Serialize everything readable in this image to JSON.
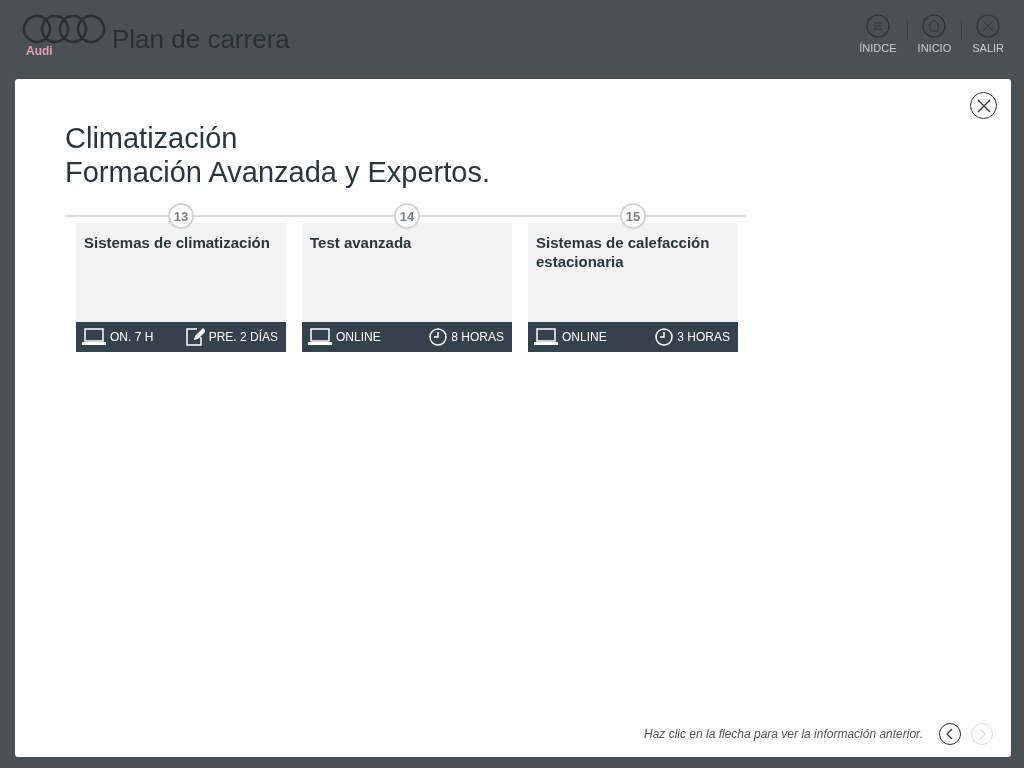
{
  "header": {
    "logo_text": "Audi",
    "title": "Plan de carrera",
    "nav": [
      {
        "label": "ÍNIDCE",
        "kind": "index"
      },
      {
        "label": "INICIO",
        "kind": "home"
      },
      {
        "label": "SALIR",
        "kind": "exit"
      }
    ]
  },
  "modal": {
    "title_lines": [
      "Climatización",
      "Formación Avanzada y Expertos."
    ],
    "courses": [
      {
        "number": "13",
        "title": "Sistemas de climatización",
        "meta": [
          {
            "kind": "laptop",
            "text": "ON. 7 H"
          },
          {
            "kind": "edit",
            "text": "PRE. 2 DÍAS"
          }
        ]
      },
      {
        "number": "14",
        "title": "Test avanzada",
        "meta": [
          {
            "kind": "laptop",
            "text": "ONLINE"
          },
          {
            "kind": "clock",
            "text": "8 HORAS"
          }
        ]
      },
      {
        "number": "15",
        "title": "Sistemas de calefacción estacionaria",
        "meta": [
          {
            "kind": "laptop",
            "text": "ONLINE"
          },
          {
            "kind": "clock",
            "text": "3 HORAS"
          }
        ]
      }
    ],
    "hint": "Haz clic en la flecha para ver la información anterior.",
    "prev_disabled": false,
    "next_disabled": true
  }
}
